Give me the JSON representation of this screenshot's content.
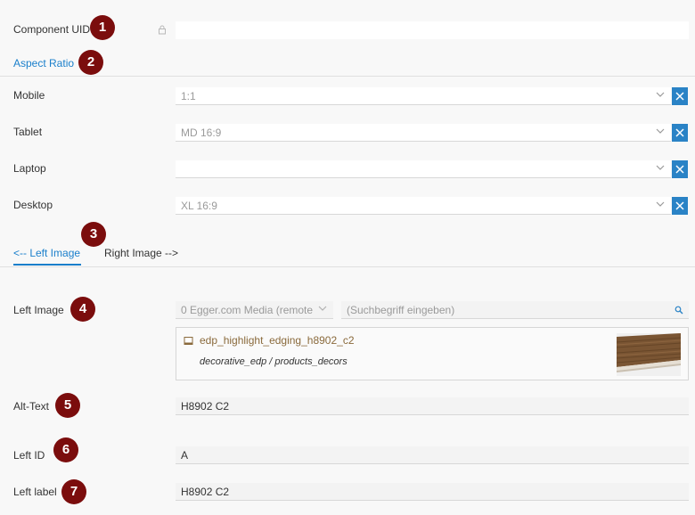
{
  "header": {
    "component_uid_label": "Component UID",
    "component_uid_value": "",
    "aspect_ratio_label": "Aspect Ratio"
  },
  "aspect_ratio": {
    "rows": [
      {
        "label": "Mobile",
        "value": "1:1"
      },
      {
        "label": "Tablet",
        "value": "MD 16:9"
      },
      {
        "label": "Laptop",
        "value": ""
      },
      {
        "label": "Desktop",
        "value": "XL 16:9"
      }
    ]
  },
  "tabs": [
    {
      "label": "<-- Left Image",
      "active": true
    },
    {
      "label": "Right Image -->",
      "active": false
    }
  ],
  "left_image": {
    "label": "Left Image",
    "source_value": "0 Egger.com Media (remote",
    "search_placeholder": "(Suchbegriff eingeben)",
    "media_item": {
      "title": "edp_highlight_edging_h8902_c2",
      "path": "decorative_edp / products_decors"
    }
  },
  "fields": {
    "alt_text": {
      "label": "Alt-Text",
      "value": "H8902 C2"
    },
    "left_id": {
      "label": "Left ID",
      "value": "A"
    },
    "left_label": {
      "label": "Left label",
      "value": "H8902 C2"
    }
  },
  "badges": [
    "1",
    "2",
    "3",
    "4",
    "5",
    "6",
    "7"
  ],
  "colors": {
    "accent": "#1a7fcb",
    "badge": "#7b0d0d",
    "clear_button": "#2a83c6"
  }
}
